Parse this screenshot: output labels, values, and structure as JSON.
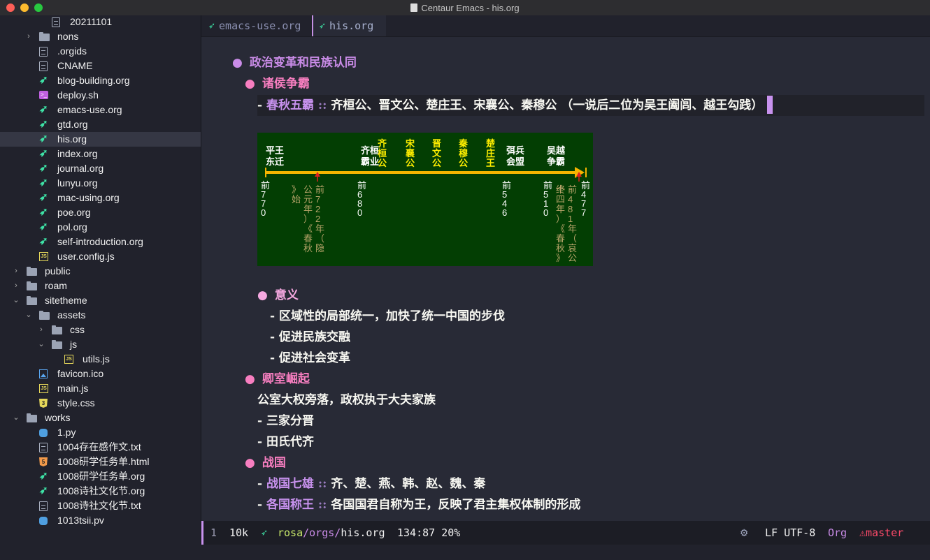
{
  "window": {
    "title": "Centaur Emacs - his.org"
  },
  "sidebar": {
    "items": [
      {
        "label": "20211101",
        "icon": "doc",
        "indent": 2,
        "arrow": ""
      },
      {
        "label": "nons",
        "icon": "folder",
        "indent": 1,
        "arrow": "›"
      },
      {
        "label": ".orgids",
        "icon": "doc",
        "indent": 1,
        "arrow": ""
      },
      {
        "label": "CNAME",
        "icon": "doc",
        "indent": 1,
        "arrow": ""
      },
      {
        "label": "blog-building.org",
        "icon": "unicorn",
        "indent": 1,
        "arrow": ""
      },
      {
        "label": "deploy.sh",
        "icon": "sh",
        "indent": 1,
        "arrow": ""
      },
      {
        "label": "emacs-use.org",
        "icon": "unicorn",
        "indent": 1,
        "arrow": ""
      },
      {
        "label": "gtd.org",
        "icon": "unicorn",
        "indent": 1,
        "arrow": ""
      },
      {
        "label": "his.org",
        "icon": "unicorn",
        "indent": 1,
        "arrow": "",
        "selected": true
      },
      {
        "label": "index.org",
        "icon": "unicorn",
        "indent": 1,
        "arrow": ""
      },
      {
        "label": "journal.org",
        "icon": "unicorn",
        "indent": 1,
        "arrow": ""
      },
      {
        "label": "lunyu.org",
        "icon": "unicorn",
        "indent": 1,
        "arrow": ""
      },
      {
        "label": "mac-using.org",
        "icon": "unicorn",
        "indent": 1,
        "arrow": ""
      },
      {
        "label": "poe.org",
        "icon": "unicorn",
        "indent": 1,
        "arrow": ""
      },
      {
        "label": "pol.org",
        "icon": "unicorn",
        "indent": 1,
        "arrow": ""
      },
      {
        "label": "self-introduction.org",
        "icon": "unicorn",
        "indent": 1,
        "arrow": ""
      },
      {
        "label": "user.config.js",
        "icon": "js",
        "indent": 1,
        "arrow": ""
      },
      {
        "label": "public",
        "icon": "folder",
        "indent": 0,
        "arrow": "›"
      },
      {
        "label": "roam",
        "icon": "folder",
        "indent": 0,
        "arrow": "›"
      },
      {
        "label": "sitetheme",
        "icon": "folder",
        "indent": 0,
        "arrow": "⌄"
      },
      {
        "label": "assets",
        "icon": "folder",
        "indent": 1,
        "arrow": "⌄"
      },
      {
        "label": "css",
        "icon": "folder",
        "indent": 2,
        "arrow": "›"
      },
      {
        "label": "js",
        "icon": "folder",
        "indent": 2,
        "arrow": "⌄"
      },
      {
        "label": "utils.js",
        "icon": "js",
        "indent": 3,
        "arrow": ""
      },
      {
        "label": "favicon.ico",
        "icon": "img",
        "indent": 1,
        "arrow": ""
      },
      {
        "label": "main.js",
        "icon": "js",
        "indent": 1,
        "arrow": ""
      },
      {
        "label": "style.css",
        "icon": "css",
        "indent": 1,
        "arrow": ""
      },
      {
        "label": "works",
        "icon": "folder",
        "indent": 0,
        "arrow": "⌄"
      },
      {
        "label": "1.py",
        "icon": "py",
        "indent": 1,
        "arrow": ""
      },
      {
        "label": "1004存在感作文.txt",
        "icon": "doc",
        "indent": 1,
        "arrow": ""
      },
      {
        "label": "1008研学任务单.html",
        "icon": "html",
        "indent": 1,
        "arrow": ""
      },
      {
        "label": "1008研学任务单.org",
        "icon": "unicorn",
        "indent": 1,
        "arrow": ""
      },
      {
        "label": "1008诗社文化节.org",
        "icon": "unicorn",
        "indent": 1,
        "arrow": ""
      },
      {
        "label": "1008诗社文化节.txt",
        "icon": "doc",
        "indent": 1,
        "arrow": ""
      },
      {
        "label": "1013tsii.pv",
        "icon": "py",
        "indent": 1,
        "arrow": ""
      }
    ]
  },
  "tabs": [
    {
      "label": "emacs-use.org",
      "active": false
    },
    {
      "label": "his.org",
      "active": true
    }
  ],
  "doc": {
    "h1": "政治变革和民族认同",
    "h2_1": "诸侯争霸",
    "wuba_term": "春秋五霸",
    "wuba_desc": "齐桓公、晋文公、楚庄王、宋襄公、秦穆公 （一说后二位为吴王阖闾、越王勾践）",
    "sep": "::",
    "dash": "-",
    "bullet": "●",
    "h3_meaning": "意义",
    "meaning_items": [
      "区域性的局部统一，加快了统一中国的步伐",
      "促进民族交融",
      "促进社会变革"
    ],
    "h2_2": "卿室崛起",
    "qingshi_text": "公室大权旁落，政权执于大夫家族",
    "qingshi_items": [
      "三家分晋",
      "田氏代齐"
    ],
    "h2_3": "战国",
    "zg1_term": "战国七雄",
    "zg1_desc": "齐、楚、燕、韩、赵、魏、秦",
    "zg2_term": "各国称王",
    "zg2_desc": "各国国君自称为王，反映了君主集权体制的形成"
  },
  "timeline": {
    "top_labels": [
      {
        "text": "平王东迁",
        "color": "white"
      },
      {
        "text": "齐桓霸业",
        "color": "white"
      },
      {
        "text": "齐桓公",
        "color": "yellow"
      },
      {
        "text": "宋襄公",
        "color": "yellow"
      },
      {
        "text": "晋文公",
        "color": "yellow"
      },
      {
        "text": "秦穆公",
        "color": "yellow"
      },
      {
        "text": "楚庄王",
        "color": "yellow"
      },
      {
        "text": "弭兵会盟",
        "color": "white"
      },
      {
        "text": "吴越争霸",
        "color": "white"
      }
    ],
    "years": [
      "前770",
      "前680",
      "前546",
      "前510",
      "前477"
    ],
    "notes": [
      "前722年（隐公元年）《春秋》始",
      "前481年（哀公十四年）《春秋》终"
    ]
  },
  "modeline": {
    "num": "1",
    "size": "10k",
    "path_user": "rosa",
    "path_dir": "/orgs/",
    "path_file": "his.org",
    "pos": "134:87 20%",
    "eol": "LF UTF-8",
    "mode": "Org",
    "branch": "master"
  },
  "colors": {
    "heading1": "#ca8ce8",
    "heading2": "#f77ec0",
    "term": "#c892ee",
    "accent": "#3ee2a6"
  }
}
